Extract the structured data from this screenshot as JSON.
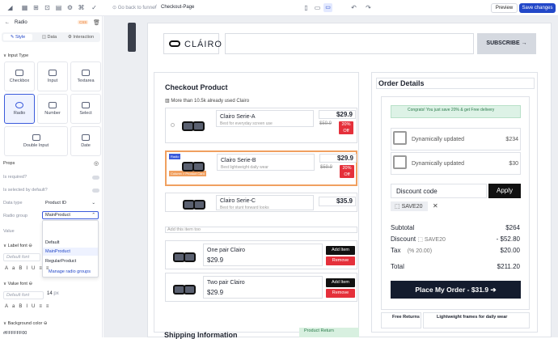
{
  "topbar": {
    "back_label": "Go back to funnel",
    "page_name": "Checkout-Page",
    "preview_label": "Preview",
    "save_label": "Save changes"
  },
  "sidebar": {
    "title": "Radio",
    "badge": "CSS",
    "tabs": [
      "Style",
      "Data",
      "Interaction"
    ],
    "input_type_heading": "Input Type",
    "tiles": [
      "Checkbox",
      "Input",
      "Textarea",
      "Radio",
      "Number",
      "Select",
      "Double Input",
      "Date"
    ],
    "props_heading": "Props",
    "is_required": "Is required?",
    "is_selected": "Is selected by default?",
    "data_type_label": "Data type",
    "data_type_value": "Product ID",
    "radio_group_label": "Radio group",
    "radio_group_value": "MainProduct",
    "value_label": "Value",
    "dropdown_options": [
      "Default",
      "MainProduct",
      "RegularProduct"
    ],
    "manage_label": "Manage radio groups",
    "label_font": "Label font",
    "default_font": "Default font",
    "value_font": "Value font",
    "default_font2": "Default font",
    "font_size": "14",
    "font_unit": "px",
    "bg_color_label": "Background color",
    "bg_color_value": "#FFFFFF00"
  },
  "page": {
    "logo_text": "CLÁIRO",
    "subscribe_label": "SUBSCRIBE",
    "checkout_title": "Checkout Product",
    "social_proof": "More than 10.5k already used Clairo",
    "products": [
      {
        "name": "Clairo Serie-A",
        "desc": "Best for everyday screen use",
        "price": "$29.9",
        "old": "$59.9",
        "discount": "20% Off"
      },
      {
        "name": "Clairo Serie-B",
        "desc": "Best lightweight daily wear",
        "price": "$29.9",
        "old": "$59.9",
        "discount": "20% Off"
      },
      {
        "name": "Clairo Serie-C",
        "desc": "Best for stunt forward looks",
        "price": "$35.9"
      }
    ],
    "add_item_placeholder": "Add this item too",
    "upsells": [
      {
        "name": "One pair Clairo",
        "price": "$29.9",
        "add": "Add Item",
        "remove": "Remove"
      },
      {
        "name": "Two pair Clairo",
        "price": "$29.9",
        "add": "Add Item",
        "remove": "Remove"
      }
    ],
    "shipping_title": "Shipping Information",
    "product_return": "Product Return",
    "order_title": "Order Details",
    "congrats": "Congrats! You just save 20% & get Free delivery",
    "dynamic_items": [
      {
        "label": "Dynamically updated",
        "price": "$234"
      },
      {
        "label": "Dynamically updated",
        "price": "$30"
      }
    ],
    "discount_placeholder": "Discount code",
    "apply_label": "Apply",
    "coupon": "SAVE20",
    "subtotal_label": "Subtotal",
    "subtotal_value": "$264",
    "discount_label": "Discount",
    "discount_code": "SAVE20",
    "discount_value": "- $52.80",
    "tax_label": "Tax",
    "tax_rate": "(% 20.00)",
    "tax_value": "$20.00",
    "total_label": "Total",
    "total_value": "$211.20",
    "place_order": "Place My Order - $31.9",
    "free_returns": "Free Returns",
    "lightweight": "Lightweight frames for daily wear",
    "radio_tag": "Radio",
    "row_tag": "Column > Product Card"
  }
}
